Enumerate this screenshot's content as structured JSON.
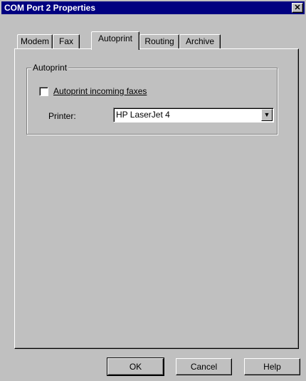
{
  "window": {
    "title": "COM Port 2 Properties",
    "close_glyph": "✕"
  },
  "tabs": [
    {
      "label": "Modem",
      "active": false
    },
    {
      "label": "Fax",
      "active": false
    },
    {
      "label": "Autoprint",
      "active": true
    },
    {
      "label": "Routing",
      "active": false
    },
    {
      "label": "Archive",
      "active": false
    }
  ],
  "autoprint_group": {
    "legend": "Autoprint",
    "checkbox_label": "Autoprint incoming faxes",
    "checked": false,
    "printer_label": "Printer:",
    "printer_value": "HP LaserJet 4"
  },
  "buttons": {
    "ok": "OK",
    "cancel": "Cancel",
    "help": "Help"
  },
  "colors": {
    "face": "#c0c0c0",
    "titlebar": "#000080"
  },
  "icons": {
    "close": "close-icon",
    "dropdown": "chevron-down-icon"
  }
}
